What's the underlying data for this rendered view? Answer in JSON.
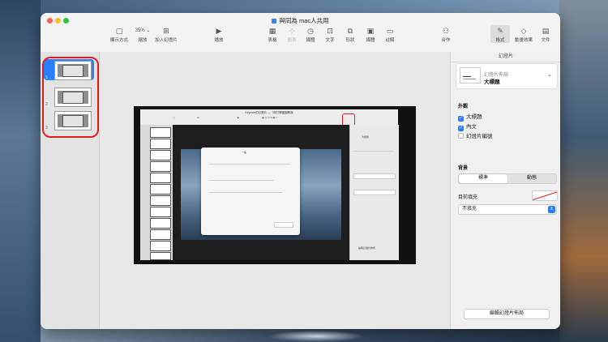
{
  "window": {
    "doc_title": "與同為 mac人共用",
    "accent_color": "#2a7fff"
  },
  "toolbar": {
    "view_label": "顯示方式",
    "zoom_value": "35%",
    "zoom_label": "縮放",
    "add_slide_label": "加入幻燈片",
    "play_label": "播放",
    "table_label": "表格",
    "chart_label": "圖表",
    "media_label": "媒體",
    "text_label": "文字",
    "shape_label": "形狀",
    "image_label": "媒體",
    "comment_label": "註解",
    "collaborate_label": "合作",
    "format_label": "格式",
    "animate_label": "動畫效果",
    "document_label": "文件"
  },
  "slide_nav": {
    "slides": [
      {
        "number": "1",
        "selected": true
      },
      {
        "number": "2",
        "selected": false
      },
      {
        "number": "3",
        "selected": false
      }
    ]
  },
  "inner_screenshot": {
    "title": "Keynote的幻燈片 —「改打學圖圖教與",
    "dialog_title": "一般",
    "sidebar_value": "大標題",
    "sidebar_btn": "編輯幻燈片佈局"
  },
  "inspector": {
    "tab_title": "幻燈片",
    "layout": {
      "label": "幻燈片佈局",
      "value": "大標題"
    },
    "appearance_title": "外觀",
    "checkboxes": [
      {
        "label": "大標題",
        "checked": true
      },
      {
        "label": "內文",
        "checked": true
      },
      {
        "label": "幻燈片編號",
        "checked": false
      }
    ],
    "background_title": "背景",
    "segments": {
      "standard": "標準",
      "dynamic": "動態"
    },
    "current_fill_label": "目前填充",
    "fill_select_value": "不填充",
    "edit_layout_button": "編輯幻燈片佈局"
  }
}
